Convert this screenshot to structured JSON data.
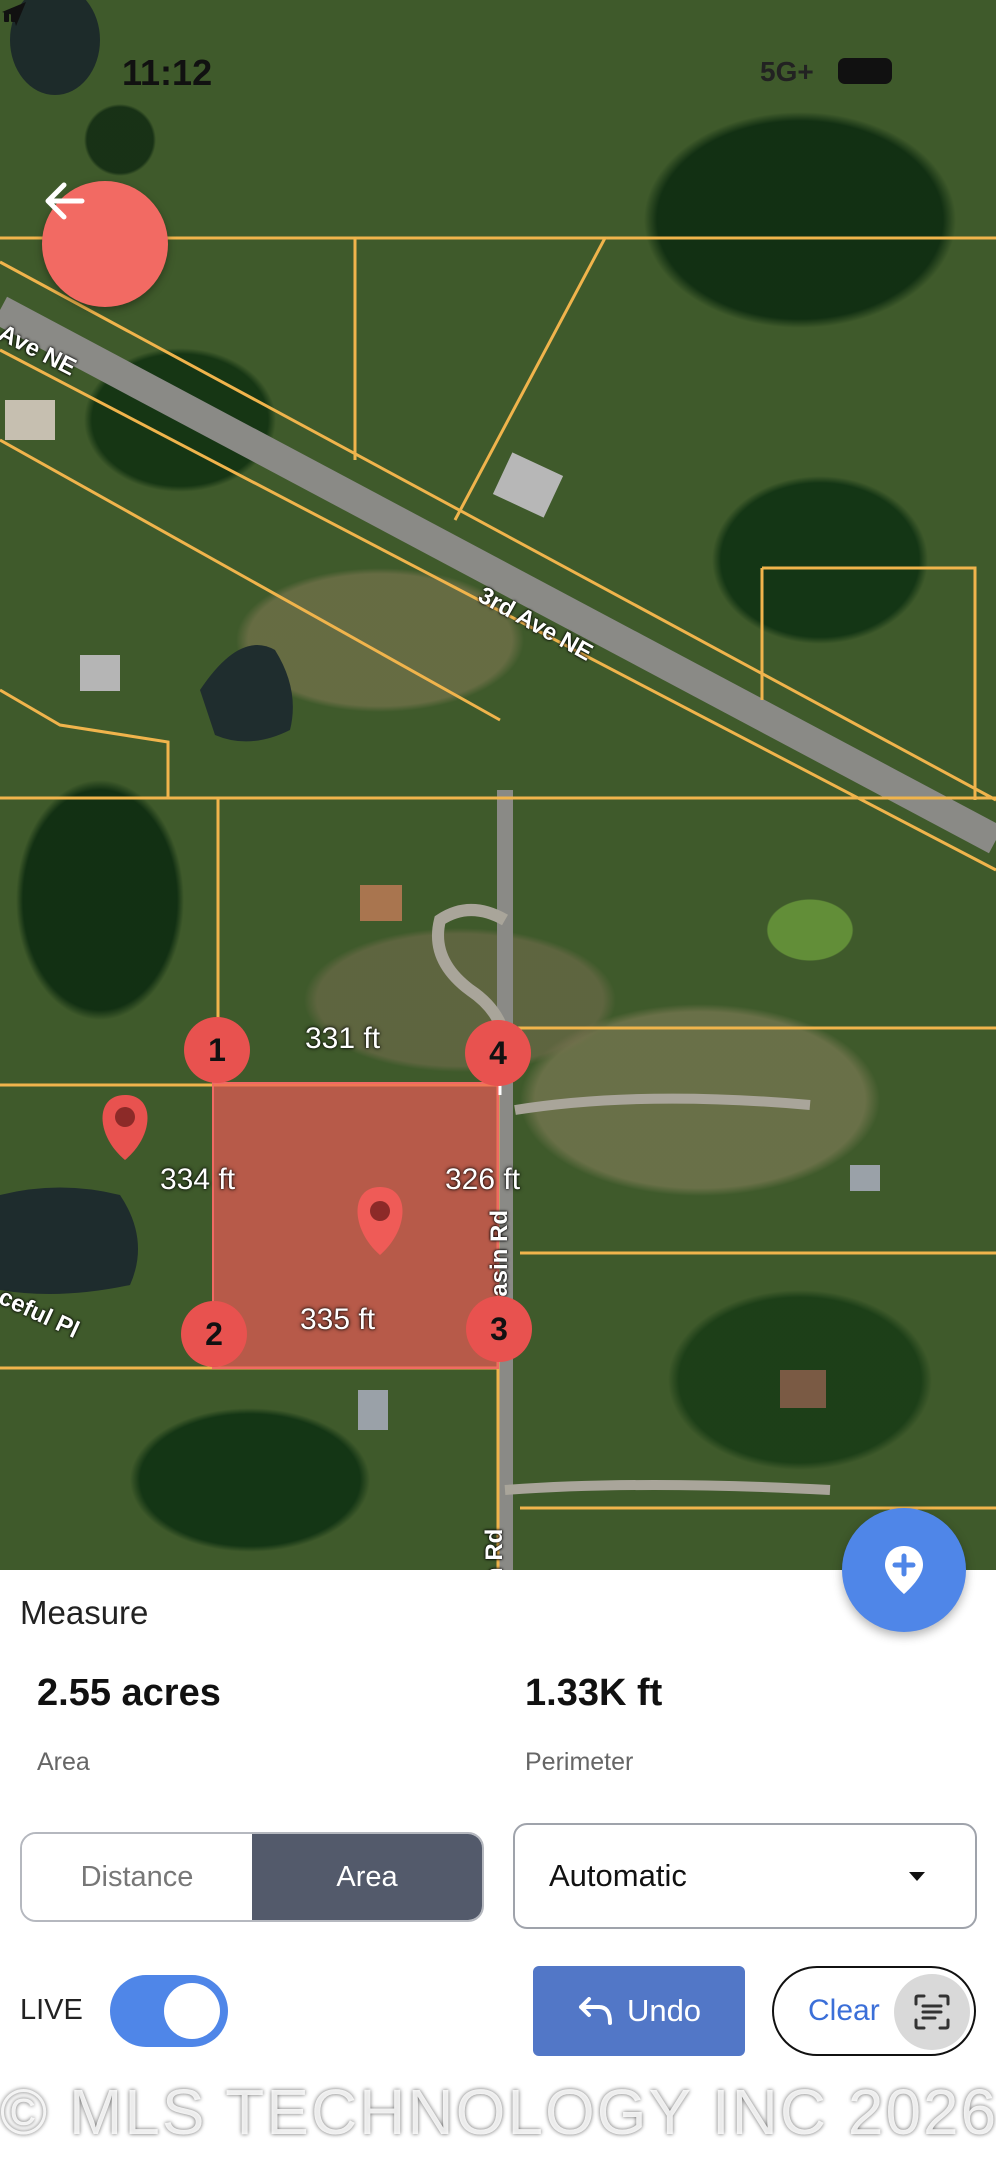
{
  "status_bar": {
    "time": "11:12",
    "network": "5G+",
    "icons": [
      "location-arrow-icon",
      "signal-icon",
      "battery-icon"
    ]
  },
  "map": {
    "road_labels": [
      "Ave NE",
      "3rd Ave NE",
      "Basin Rd",
      "n Rd",
      "ceful Pl"
    ],
    "vertices": [
      "1",
      "2",
      "3",
      "4"
    ],
    "segment_lengths": {
      "top": "331 ft",
      "left": "334 ft",
      "right": "326 ft",
      "bottom": "335 ft"
    },
    "colors": {
      "parcel_line": "#f0b44c",
      "area_fill": "#f06a63",
      "vertex": "#e8524f"
    }
  },
  "panel": {
    "title": "Measure",
    "area_value": "2.55 acres",
    "area_label": "Area",
    "perimeter_value": "1.33K ft",
    "perimeter_label": "Perimeter",
    "mode_tabs": [
      {
        "label": "Distance",
        "selected": false
      },
      {
        "label": "Area",
        "selected": true
      }
    ],
    "units_selected": "Automatic",
    "live_label": "LIVE",
    "live_enabled": true,
    "undo_label": "Undo",
    "clear_label": "Clear",
    "accent_color": "#4f86e8"
  },
  "watermark": "© MLS TECHNOLOGY INC 2026"
}
